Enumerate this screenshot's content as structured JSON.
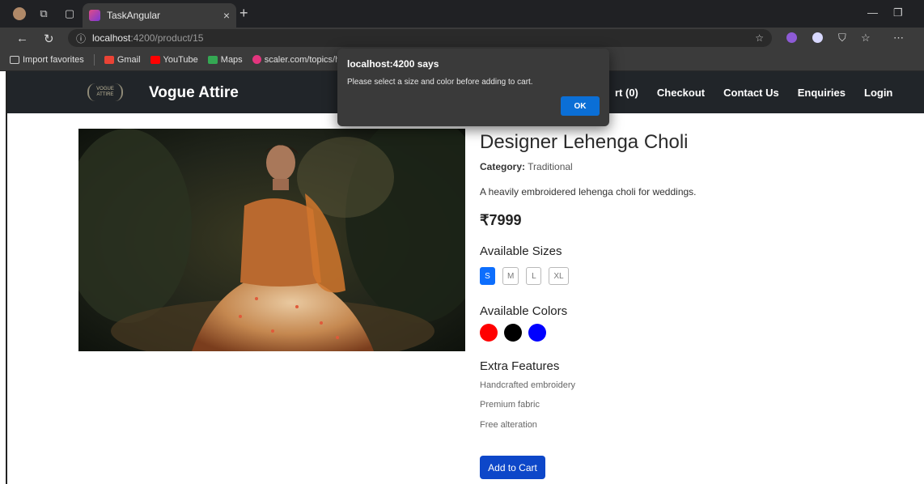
{
  "browser": {
    "tab_title": "TaskAngular",
    "tab_close": "×",
    "new_tab": "+",
    "url_host": "localhost",
    "url_path": ":4200/product/15",
    "bookmarks": [
      {
        "label": "Import favorites",
        "color": "#cfcfcf"
      },
      {
        "label": "Gmail",
        "color": "#ea4335"
      },
      {
        "label": "YouTube",
        "color": "#ff0000"
      },
      {
        "label": "Maps",
        "color": "#34a853"
      },
      {
        "label": "scaler.com/topics/h...",
        "color": "#e3357e"
      }
    ]
  },
  "navbar": {
    "logo_text": "VOGUE ATTIRE",
    "brand": "Vogue Attire",
    "links": [
      "rt (0)",
      "Checkout",
      "Contact Us",
      "Enquiries",
      "Login"
    ]
  },
  "product": {
    "title": "Designer Lehenga Choli",
    "category_label": "Category:",
    "category_value": "Traditional",
    "description": "A heavily embroidered lehenga choli for weddings.",
    "price": "₹7999",
    "sizes_heading": "Available Sizes",
    "sizes": [
      "S",
      "M",
      "L",
      "XL"
    ],
    "selected_size": "S",
    "colors_heading": "Available Colors",
    "colors": [
      "#ff0000",
      "#000000",
      "#0000ff"
    ],
    "extra_heading": "Extra Features",
    "features": [
      "Handcrafted embroidery",
      "Premium fabric",
      "Free alteration"
    ],
    "add_to_cart": "Add to Cart"
  },
  "dialog": {
    "title": "localhost:4200 says",
    "message": "Please select a size and color before adding to cart.",
    "ok": "OK"
  }
}
